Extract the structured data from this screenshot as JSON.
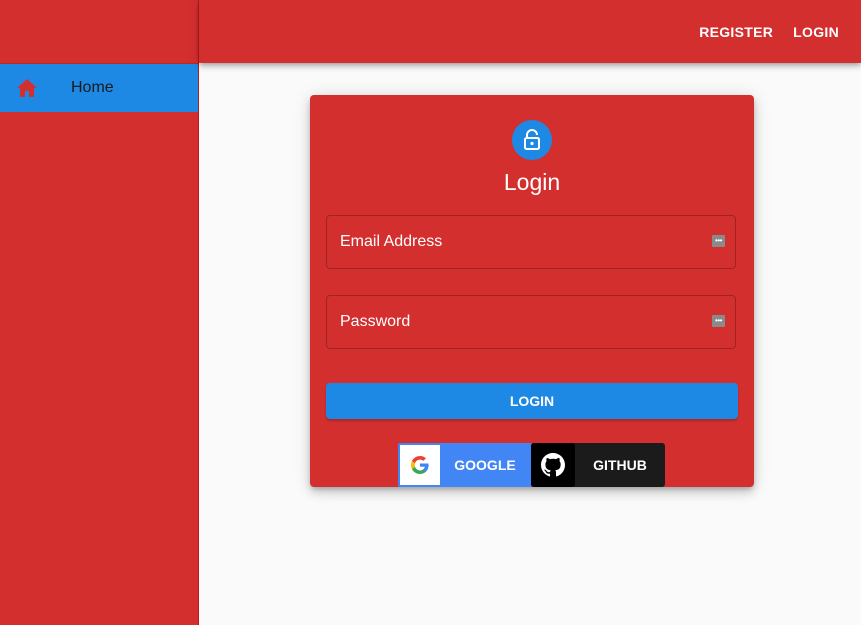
{
  "sidebar": {
    "items": [
      {
        "label": "Home",
        "icon": "home-icon"
      }
    ]
  },
  "appbar": {
    "register_label": "REGISTER",
    "login_label": "LOGIN"
  },
  "card": {
    "icon": "lock-open-icon",
    "title": "Login",
    "email_label": "Email Address",
    "password_label": "Password",
    "email_value": "",
    "password_value": "",
    "submit_label": "LOGIN",
    "google_label": "GOOGLE",
    "github_label": "GITHUB"
  },
  "colors": {
    "primary": "#d32f2f",
    "accent": "#1e88e5",
    "google": "#4285f4",
    "github": "#1b1b1b"
  }
}
